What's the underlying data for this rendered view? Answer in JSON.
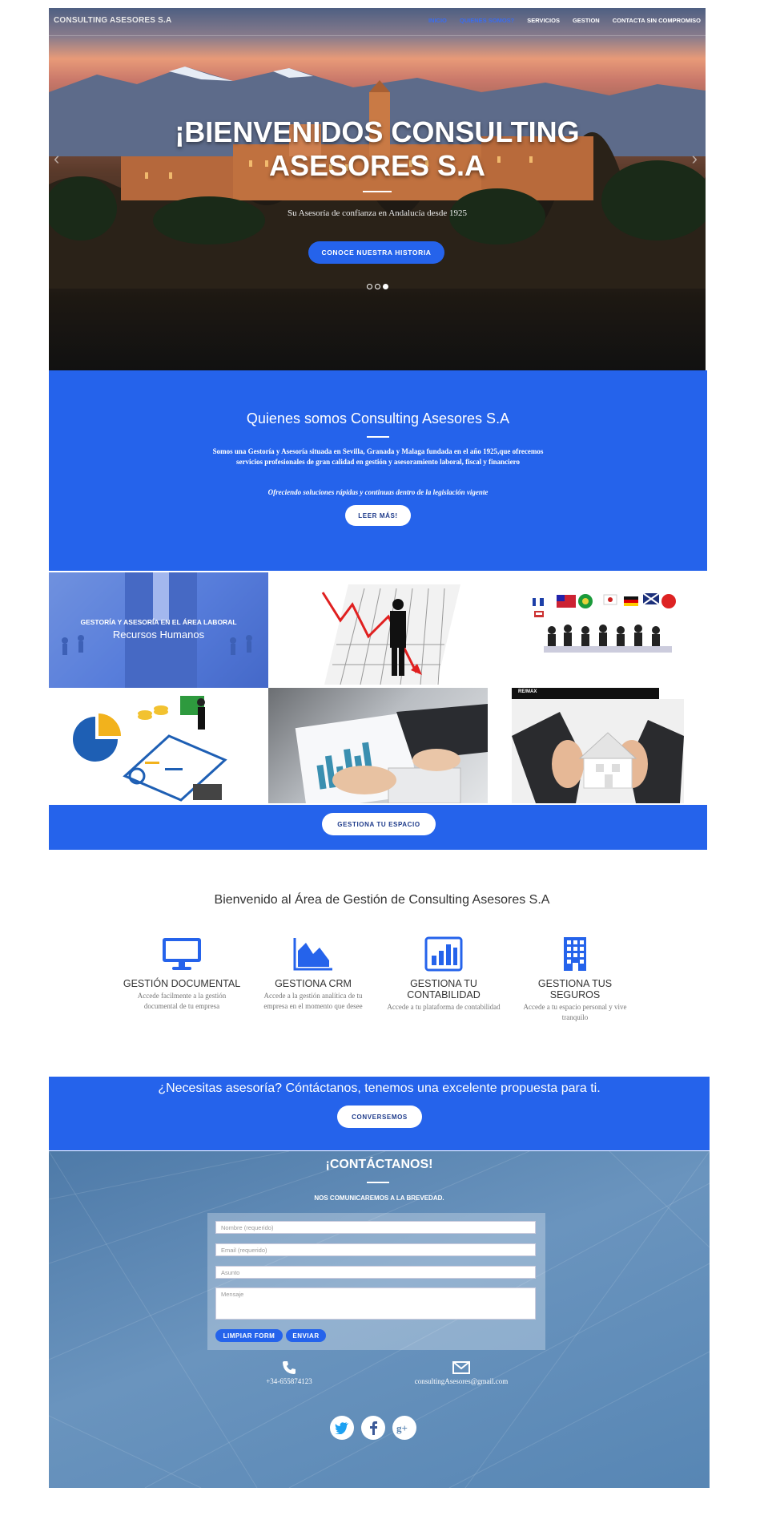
{
  "nav": {
    "brand": "CONSULTING ASESORES S.A",
    "items": [
      "INICIO",
      "QUIENES SOMOS?",
      "SERVICIOS",
      "GESTION",
      "CONTACTA SIN COMPROMISO"
    ]
  },
  "hero": {
    "title_line1": "¡BIENVENIDOS CONSULTING",
    "title_line2": "ASESORES S.A",
    "subtitle": "Su Asesoría de confianza en Andalucía desde 1925",
    "button": "CONOCE NUESTRA HISTORIA",
    "prev": "‹",
    "next": "›",
    "active_slide": 3
  },
  "about": {
    "title": "Quienes somos Consulting Asesores S.A",
    "paragraph": "Somos una Gestoría y Asesoría situada en Sevilla, Granada y Malaga fundada en el año 1925,que ofrecemos servicios profesionales de gran calidad en gestión y asesoramiento laboral, fiscal y financiero",
    "tagline": "Ofreciendo soluciones rápidas y continuas dentro de la legislación vigente",
    "button": "LEER MÁS!"
  },
  "services_grid": {
    "tile1_caption": "GESTORÍA Y ASESORÍA EN EL ÁREA LABORAL",
    "tile1_title": "Recursos Humanos",
    "tile6_label": "RE/MAX",
    "button": "GESTIONA TU ESPACIO"
  },
  "gestion": {
    "title": "Bienvenido al Área de Gestión de Consulting Asesores S.A",
    "features": [
      {
        "icon": "monitor-icon",
        "title": "GESTIÓN DOCUMENTAL",
        "text": "Accede facilmente a la gestión documental de tu empresa"
      },
      {
        "icon": "area-chart-icon",
        "title": "GESTIONA CRM",
        "text": "Accede a la gestión analítica de tu empresa en el momento que desee"
      },
      {
        "icon": "bar-chart-icon",
        "title": "GESTIONA TU CONTABILIDAD",
        "text": "Accede a tu plataforma de contabilidad"
      },
      {
        "icon": "building-icon",
        "title": "GESTIONA TUS SEGUROS",
        "text": "Accede a tu espacio personal y vive tranquilo"
      }
    ]
  },
  "cta": {
    "text": "¿Necesitas asesoría? Cóntáctanos, tenemos una excelente propuesta para ti.",
    "button": "CONVERSEMOS"
  },
  "contact": {
    "title": "¡CONTÁCTANOS!",
    "lead": "NOS COMUNICAREMOS A LA BREVEDAD.",
    "placeholders": {
      "name": "Nombre (requerido)",
      "email": "Email (requerido)",
      "subject": "Asunto",
      "message": "Mensaje"
    },
    "reset_button": "LIMPIAR FORM",
    "submit_button": "ENVIAR",
    "phone": "+34-655874123",
    "email": "consultingAsesores@gmail.com",
    "social": [
      "twitter-icon",
      "facebook-icon",
      "google-plus-icon"
    ]
  },
  "colors": {
    "accent": "#2563eb",
    "contact_bg": "#5b86b3"
  }
}
